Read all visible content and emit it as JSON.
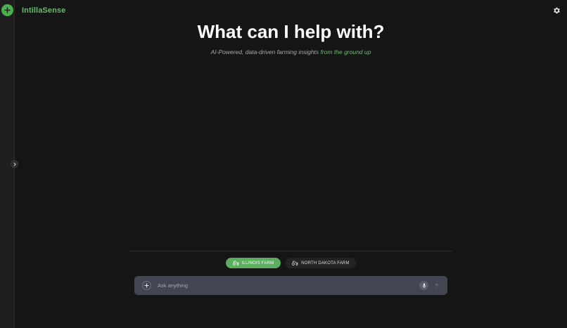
{
  "app": {
    "brand": "IntillaSense"
  },
  "hero": {
    "title": "What can I help with?",
    "subtitle_main": "AI-Powered, data-driven farming insights ",
    "subtitle_accent": "from the ground up"
  },
  "farms": [
    {
      "label": "ILLINOIS FARM",
      "selected": true,
      "icon": "tractor-icon"
    },
    {
      "label": "NORTH DAKOTA FARM",
      "selected": false,
      "icon": "tractor-icon"
    }
  ],
  "composer": {
    "placeholder": "Ask anything",
    "value": ""
  },
  "icons": {
    "new_chat": "plus-icon",
    "sidebar_toggle": "chevron-right-icon",
    "settings": "gear-icon",
    "attach": "plus-icon",
    "voice": "microphone-icon",
    "send": "arrow-up-icon"
  },
  "colors": {
    "background": "#151516",
    "brand_green": "#66bb6a",
    "chip_selected": "#5cae5f",
    "chip_default": "#232325",
    "composer_bg": "#434551"
  }
}
